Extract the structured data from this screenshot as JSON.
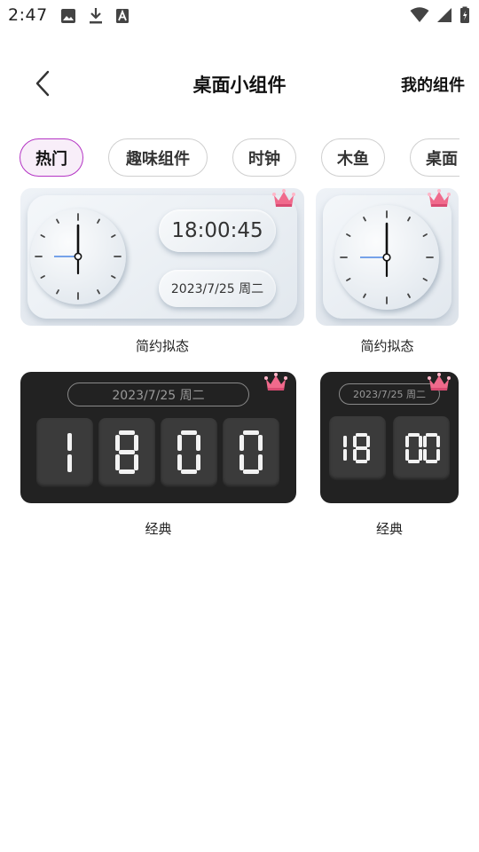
{
  "status_bar": {
    "time": "2:47",
    "left_icons": [
      "image-icon",
      "download-icon",
      "a-box-icon"
    ],
    "right_icons": [
      "wifi-icon",
      "signal-icon",
      "battery-icon"
    ]
  },
  "header": {
    "back_icon": "chevron-left-icon",
    "title": "桌面小组件",
    "my_widgets_label": "我的组件"
  },
  "tabs": [
    {
      "label": "热门",
      "active": true
    },
    {
      "label": "趣味组件",
      "active": false
    },
    {
      "label": "时钟",
      "active": false
    },
    {
      "label": "木鱼",
      "active": false
    },
    {
      "label": "桌面",
      "active": false
    }
  ],
  "colors": {
    "active_tab_border": "#b434c4",
    "active_tab_bg": "#f8eef9",
    "clock_second_hand": "#2a6fe0",
    "dark_card_bg": "#222222"
  },
  "widgets": [
    {
      "caption": "简约拟态",
      "time": "18:00:45",
      "date": "2023/7/25 周二",
      "premium_icon": "crown-icon"
    },
    {
      "caption": "简约拟态",
      "premium_icon": "crown-icon"
    },
    {
      "caption": "经典",
      "date": "2023/7/25 周二",
      "digits": [
        "1",
        "8",
        "0",
        "0"
      ],
      "premium_icon": "crown-icon"
    },
    {
      "caption": "经典",
      "date": "2023/7/25 周二",
      "hour": "18",
      "minute": "00",
      "premium_icon": "crown-icon"
    }
  ]
}
